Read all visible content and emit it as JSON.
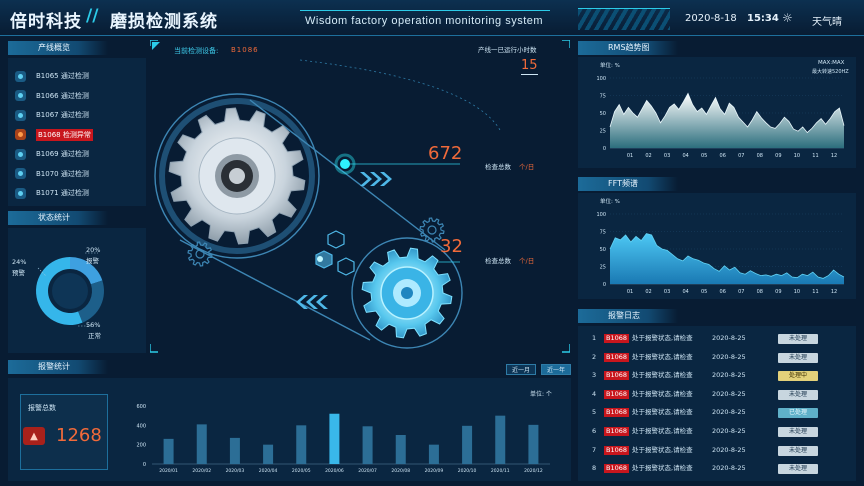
{
  "header": {
    "brand": "倍时科技",
    "separator": "//",
    "system_title": "磨损检测系统",
    "subtitle": "Wisdom factory operation monitoring system",
    "date": "2020-8-18",
    "time": "15:34",
    "weather_icon": "sun-icon",
    "weather": "天气晴"
  },
  "overview": {
    "title": "产线概览",
    "items": [
      {
        "label": "B1065  通过检测",
        "status": "ok"
      },
      {
        "label": "B1066  通过检测",
        "status": "ok"
      },
      {
        "label": "B1067  通过检测",
        "status": "ok"
      },
      {
        "label": "B1068  检测异常",
        "status": "alarm"
      },
      {
        "label": "B1069  通过检测",
        "status": "ok"
      },
      {
        "label": "B1070  通过检测",
        "status": "ok"
      },
      {
        "label": "B1071  通过检测",
        "status": "ok"
      }
    ]
  },
  "status_stats": {
    "title": "状态统计",
    "slices": [
      {
        "pct": "20%",
        "label": "报警",
        "value": 20,
        "color": "#3ea0e0"
      },
      {
        "pct": "24%",
        "label": "预警",
        "value": 24,
        "color": "#1d5f8a"
      },
      {
        "pct": "56%",
        "label": "正常",
        "value": 56,
        "color": "#35b6ea"
      }
    ]
  },
  "center": {
    "device_label": "当前检测设备:",
    "device_id": "B1086",
    "runtime_label": "产线一已运行小时数",
    "runtime_value": "15",
    "stat1_value": "672",
    "stat1_label": "检查总数",
    "stat1_unit": "个/日",
    "stat2_value": "32",
    "stat2_label": "检查总数",
    "stat2_unit": "个/日"
  },
  "rms": {
    "title": "RMS趋势图",
    "unit": "单位: %",
    "max_label": "MAX:MAX",
    "legend2": "最大转速520HZ"
  },
  "fft": {
    "title": "FFT频谱",
    "unit": "单位: %"
  },
  "alarm_log": {
    "title": "报警日志",
    "rows": [
      {
        "num": "1",
        "dev": "B1068",
        "msg": "处于报警状态,请检查",
        "date": "2020-8-25",
        "status": "未处理",
        "s": 0
      },
      {
        "num": "2",
        "dev": "B1068",
        "msg": "处于报警状态,请检查",
        "date": "2020-8-25",
        "status": "未处理",
        "s": 0
      },
      {
        "num": "3",
        "dev": "B1068",
        "msg": "处于报警状态,请检查",
        "date": "2020-8-25",
        "status": "处理中",
        "s": 1
      },
      {
        "num": "4",
        "dev": "B1068",
        "msg": "处于报警状态,请检查",
        "date": "2020-8-25",
        "status": "未处理",
        "s": 0
      },
      {
        "num": "5",
        "dev": "B1068",
        "msg": "处于报警状态,请检查",
        "date": "2020-8-25",
        "status": "已处理",
        "s": 2
      },
      {
        "num": "6",
        "dev": "B1068",
        "msg": "处于报警状态,请检查",
        "date": "2020-8-25",
        "status": "未处理",
        "s": 0
      },
      {
        "num": "7",
        "dev": "B1068",
        "msg": "处于报警状态,请检查",
        "date": "2020-8-25",
        "status": "未处理",
        "s": 0
      },
      {
        "num": "8",
        "dev": "B1068",
        "msg": "处于报警状态,请检查",
        "date": "2020-8-25",
        "status": "未处理",
        "s": 0
      }
    ]
  },
  "alarm_stats": {
    "title": "报警统计",
    "btn_month": "近一月",
    "btn_year": "近一年",
    "unit": "单位: 个",
    "total_label": "报警总数",
    "total_value": "1268"
  },
  "chart_data": [
    {
      "type": "bar",
      "title": "",
      "categories": [
        "2020/01",
        "2020/02",
        "2020/03",
        "2020/04",
        "2020/05",
        "2020/06",
        "2020/07",
        "2020/08",
        "2020/09",
        "2020/10",
        "2020/11",
        "2020/12"
      ],
      "values": [
        260,
        410,
        270,
        200,
        400,
        520,
        390,
        300,
        200,
        395,
        500,
        405
      ],
      "ylim": [
        0,
        600
      ],
      "yticks": [
        "0",
        "200",
        "400",
        "600"
      ],
      "highlight_index": 5
    },
    {
      "type": "area",
      "title": "",
      "xticks": [
        "01",
        "02",
        "03",
        "04",
        "05",
        "06",
        "07",
        "08",
        "09",
        "10",
        "11",
        "12"
      ],
      "ylim": [
        0,
        100
      ],
      "yticks": [
        "0",
        "25",
        "50",
        "75",
        "100"
      ],
      "values": [
        30,
        52,
        62,
        48,
        58,
        50,
        44,
        56,
        68,
        60,
        50,
        36,
        46,
        58,
        63,
        55,
        66,
        78,
        62,
        52,
        57,
        48,
        60,
        72,
        56,
        48,
        64,
        58,
        44,
        37,
        30,
        40,
        52,
        43,
        36,
        30,
        28,
        35,
        44,
        38,
        27,
        24,
        30,
        22,
        28,
        36,
        42,
        34,
        42,
        52,
        57,
        32
      ]
    },
    {
      "type": "area",
      "title": "",
      "xticks": [
        "01",
        "02",
        "03",
        "04",
        "05",
        "06",
        "07",
        "08",
        "09",
        "10",
        "11",
        "12"
      ],
      "ylim": [
        0,
        100
      ],
      "yticks": [
        "0",
        "25",
        "50",
        "75",
        "100"
      ],
      "values": [
        50,
        66,
        63,
        70,
        60,
        68,
        62,
        72,
        70,
        55,
        50,
        48,
        42,
        36,
        33,
        40,
        36,
        34,
        30,
        28,
        22,
        18,
        26,
        20,
        24,
        16,
        14,
        19,
        15,
        12,
        13,
        11,
        14,
        12,
        16,
        10,
        9,
        14,
        12,
        17,
        10,
        8,
        12,
        20,
        14,
        10
      ]
    }
  ]
}
